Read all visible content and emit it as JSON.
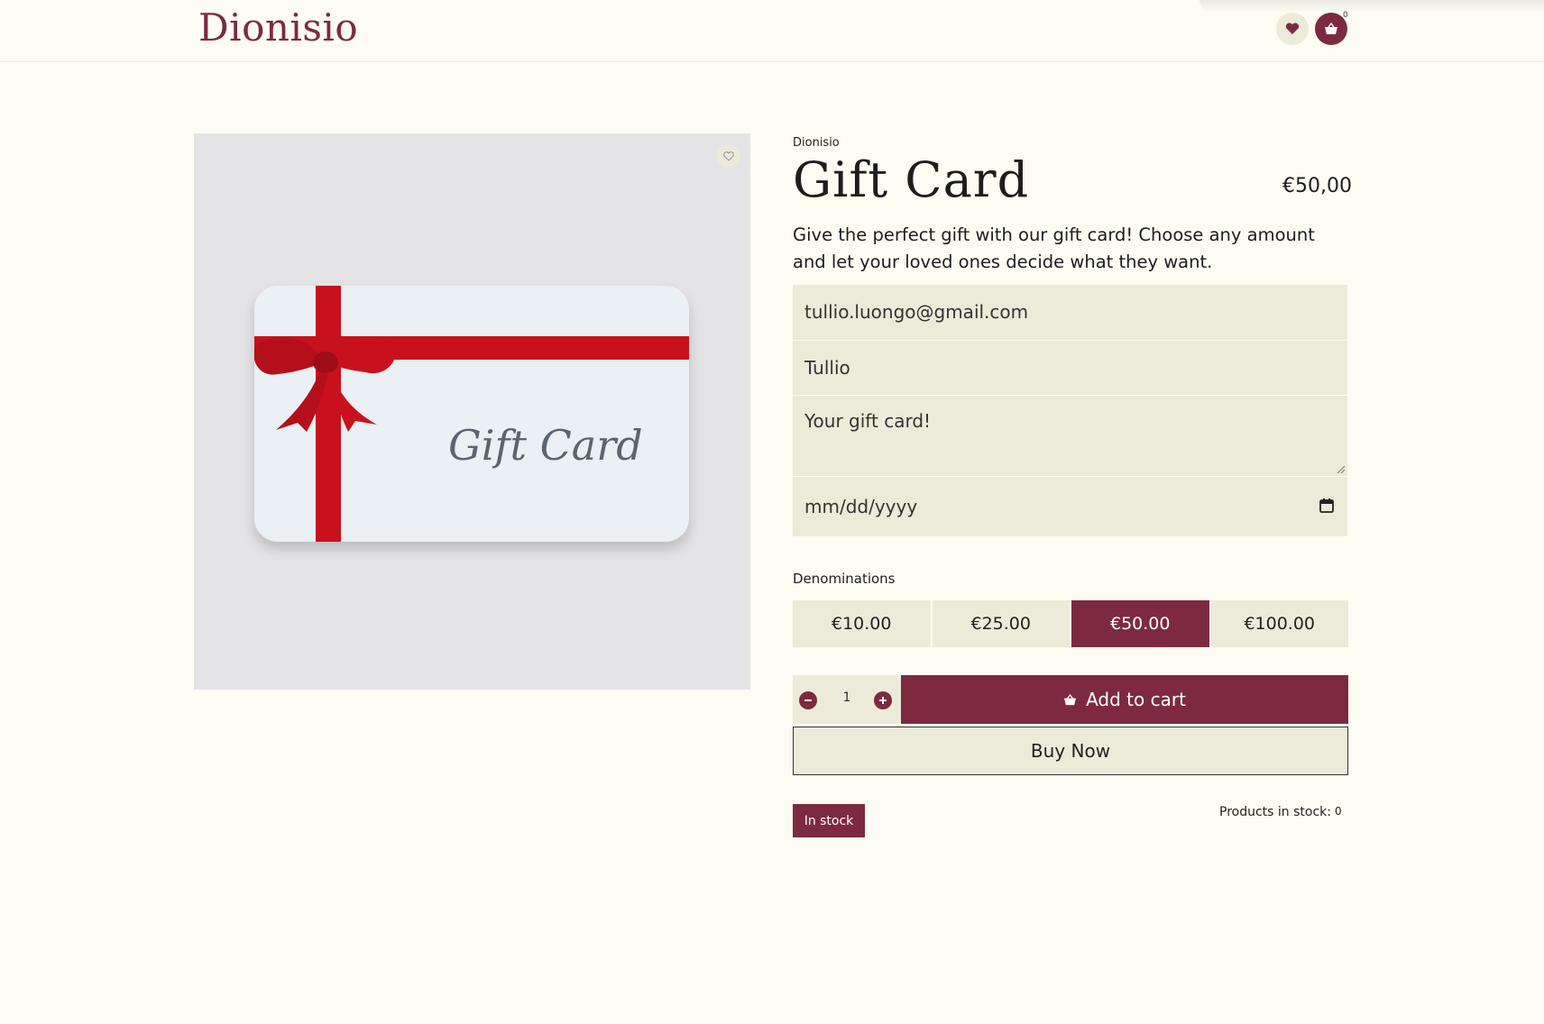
{
  "header": {
    "logo": "Dionisio",
    "cart_count": "0",
    "icons": {
      "wishlist": "heart-icon",
      "cart": "basket-icon"
    }
  },
  "product": {
    "image_text": "Gift Card",
    "brand": "Dionisio",
    "title": "Gift Card",
    "price": "€50,00",
    "description": "Give the perfect gift with our gift card! Choose any amount and let your loved ones decide what they want."
  },
  "form": {
    "email": "tullio.luongo@gmail.com",
    "name": "Tullio",
    "message": "Your gift card!",
    "date_placeholder": "mm/dd/yyyy"
  },
  "denominations": {
    "label": "Denominations",
    "options": [
      "€10.00",
      "€25.00",
      "€50.00",
      "€100.00"
    ],
    "selected": "€50.00"
  },
  "purchase": {
    "quantity": "1",
    "add_to_cart": "Add to cart",
    "buy_now": "Buy Now"
  },
  "stock": {
    "badge": "In stock",
    "label": "Products in stock:",
    "count": "0"
  },
  "colors": {
    "accent": "#7d2a40",
    "background": "#fcfcf3",
    "field": "#ecebd9"
  }
}
